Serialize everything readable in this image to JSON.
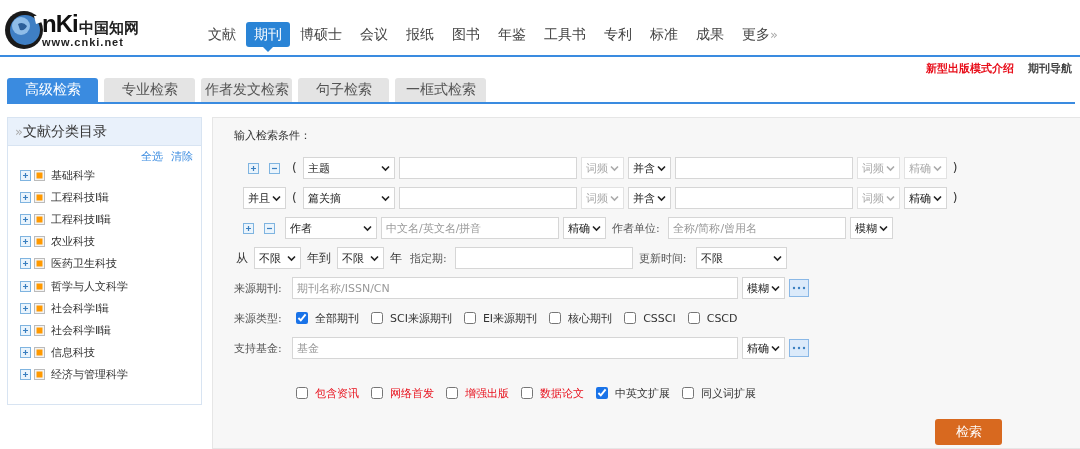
{
  "logo": {
    "wordmark": "nKi",
    "chinese": "中国知网",
    "url": "www.cnki.net"
  },
  "nav": [
    {
      "label": "文献",
      "selected": false
    },
    {
      "label": "期刊",
      "selected": true
    },
    {
      "label": "博硕士",
      "selected": false
    },
    {
      "label": "会议",
      "selected": false
    },
    {
      "label": "报纸",
      "selected": false
    },
    {
      "label": "图书",
      "selected": false
    },
    {
      "label": "年鉴",
      "selected": false
    },
    {
      "label": "工具书",
      "selected": false
    },
    {
      "label": "专利",
      "selected": false
    },
    {
      "label": "标准",
      "selected": false
    },
    {
      "label": "成果",
      "selected": false
    },
    {
      "label": "更多",
      "more": "»"
    }
  ],
  "top_links": [
    {
      "text": "新型出版模式介绍",
      "kind": "highlight"
    },
    {
      "text": "期刊导航",
      "kind": "plain"
    }
  ],
  "search_tabs": [
    {
      "label": "高级检索",
      "selected": true
    },
    {
      "label": "专业检索",
      "selected": false
    },
    {
      "label": "作者发文检索",
      "selected": false
    },
    {
      "label": "句子检索",
      "selected": false
    },
    {
      "label": "一框式检索",
      "selected": false
    }
  ],
  "sidebar": {
    "marker": "»",
    "title": "文献分类目录",
    "actions": [
      "全选",
      "清除"
    ],
    "items": [
      {
        "label": "基础科学",
        "expanded": false
      },
      {
        "label": "工程科技Ⅰ辑",
        "expanded": false
      },
      {
        "label": "工程科技Ⅱ辑",
        "expanded": false
      },
      {
        "label": "农业科技",
        "expanded": false
      },
      {
        "label": "医药卫生科技",
        "expanded": false
      },
      {
        "label": "哲学与人文科学",
        "expanded": false
      },
      {
        "label": "社会科学Ⅰ辑",
        "expanded": false
      },
      {
        "label": "社会科学Ⅱ辑",
        "expanded": false
      },
      {
        "label": "信息科技",
        "expanded": false
      },
      {
        "label": "经济与管理科学",
        "expanded": false
      }
    ]
  },
  "form": {
    "heading": "输入检索条件：",
    "rows": [
      {
        "kind": "condition",
        "parts": [
          {
            "kind": "add_button"
          },
          {
            "kind": "remove_button"
          },
          {
            "kind": "text",
            "text": "("
          },
          {
            "kind": "field_select",
            "value": "主题",
            "disabled": false
          },
          {
            "kind": "input"
          },
          {
            "kind": "select",
            "value": "词频",
            "disabled": true
          },
          {
            "kind": "select",
            "value": "并含",
            "disabled": false
          },
          {
            "kind": "input"
          },
          {
            "kind": "select",
            "value": "词频",
            "disabled": true
          },
          {
            "kind": "select",
            "value": "精确",
            "disabled": true
          },
          {
            "kind": "text",
            "text": ")"
          }
        ]
      },
      {
        "kind": "condition",
        "parts": [
          {
            "kind": "select",
            "value": "并且",
            "disabled": false
          },
          {
            "kind": "text",
            "text": "("
          },
          {
            "kind": "field_select",
            "value": "篇关摘",
            "disabled": false
          },
          {
            "kind": "input"
          },
          {
            "kind": "select",
            "value": "词频",
            "disabled": true
          },
          {
            "kind": "select",
            "value": "并含",
            "disabled": false
          },
          {
            "kind": "input"
          },
          {
            "kind": "select",
            "value": "词频",
            "disabled": true
          },
          {
            "kind": "select",
            "value": "精确",
            "disabled": false
          },
          {
            "kind": "text",
            "text": ")"
          }
        ]
      },
      {
        "kind": "condition",
        "parts": [
          {
            "kind": "add_button"
          },
          {
            "kind": "remove_button"
          },
          {
            "kind": "field_select",
            "value": "作者",
            "disabled": false
          },
          {
            "kind": "input",
            "placeholder": "中文名/英文名/拼音"
          },
          {
            "kind": "select",
            "value": "精确",
            "disabled": false
          },
          {
            "kind": "label",
            "text": "作者单位:"
          },
          {
            "kind": "input",
            "placeholder": "全称/简称/曾用名"
          },
          {
            "kind": "select",
            "value": "模糊",
            "disabled": false
          }
        ]
      },
      {
        "kind": "plain",
        "parts": [
          {
            "kind": "text",
            "text": "从"
          },
          {
            "kind": "mid_select",
            "value": "不限",
            "disabled": false
          },
          {
            "kind": "text",
            "text": "年到"
          },
          {
            "kind": "mid_select",
            "value": "不限",
            "disabled": false
          },
          {
            "kind": "text",
            "text": "年"
          },
          {
            "kind": "label",
            "text": "指定期:"
          },
          {
            "kind": "input"
          },
          {
            "kind": "label",
            "text": "更新时间:"
          },
          {
            "kind": "wide_select",
            "value": "不限",
            "disabled": false
          }
        ]
      },
      {
        "kind": "plain",
        "parts": [
          {
            "kind": "label",
            "text": "来源期刊:"
          },
          {
            "kind": "wide_input",
            "placeholder": "期刊名称/ISSN/CN"
          },
          {
            "kind": "select",
            "value": "模糊",
            "disabled": false
          },
          {
            "kind": "more_button"
          }
        ]
      },
      {
        "kind": "plain",
        "parts": [
          {
            "kind": "label",
            "text": "来源类型:"
          },
          {
            "kind": "checkbox",
            "text": "全部期刊",
            "checked": true
          },
          {
            "kind": "checkbox",
            "text": "SCI来源期刊",
            "checked": false
          },
          {
            "kind": "checkbox",
            "text": "EI来源期刊",
            "checked": false
          },
          {
            "kind": "checkbox",
            "text": "核心期刊",
            "checked": false
          },
          {
            "kind": "checkbox",
            "text": "CSSCI",
            "checked": false
          },
          {
            "kind": "checkbox",
            "text": "CSCD",
            "checked": false
          }
        ]
      },
      {
        "kind": "plain",
        "parts": [
          {
            "kind": "label",
            "text": "支持基金:"
          },
          {
            "kind": "wide_input",
            "placeholder": "基金"
          },
          {
            "kind": "select",
            "value": "精确",
            "disabled": false
          },
          {
            "kind": "more_button"
          }
        ]
      },
      {
        "kind": "options",
        "parts": [
          {
            "kind": "checkbox",
            "text": "包含资讯",
            "checked": false,
            "highlight": true
          },
          {
            "kind": "checkbox",
            "text": "网络首发",
            "checked": false,
            "highlight": true
          },
          {
            "kind": "checkbox",
            "text": "增强出版",
            "checked": false,
            "highlight": true
          },
          {
            "kind": "checkbox",
            "text": "数据论文",
            "checked": false,
            "highlight": true
          },
          {
            "kind": "checkbox",
            "text": "中英文扩展",
            "checked": true,
            "highlight": false
          },
          {
            "kind": "checkbox",
            "text": "同义词扩展",
            "checked": false,
            "highlight": false
          }
        ]
      }
    ],
    "submit": "检索"
  }
}
